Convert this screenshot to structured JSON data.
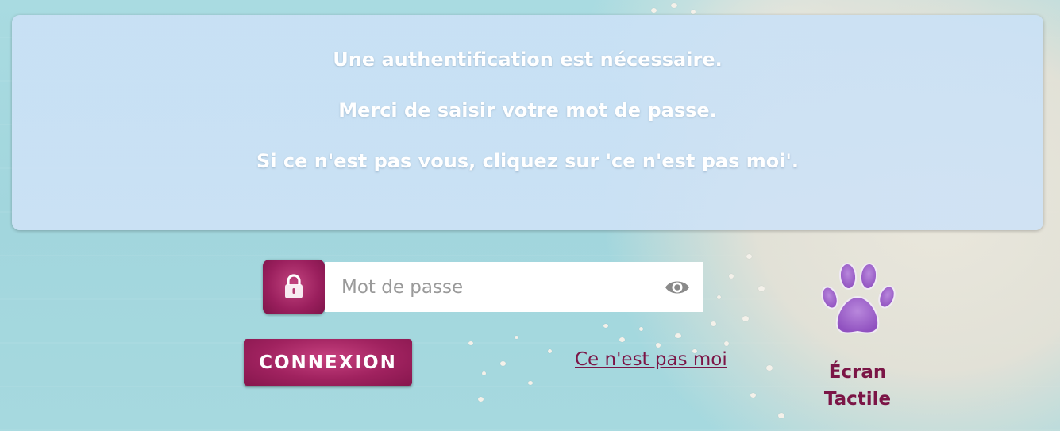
{
  "message": {
    "line1": "Une authentification est nécessaire.",
    "line2": "Merci de saisir votre mot de passe.",
    "line3": "Si ce n'est pas vous, cliquez sur 'ce n'est pas moi'."
  },
  "password": {
    "placeholder": "Mot de passe",
    "value": ""
  },
  "icons": {
    "lock": "lock-icon",
    "eye": "eye-icon",
    "paw": "paw-icon"
  },
  "buttons": {
    "connexion": "CONNEXION"
  },
  "links": {
    "not_me": "Ce n'est pas moi"
  },
  "touch_screen": {
    "line1": "Écran",
    "line2": "Tactile"
  },
  "colors": {
    "accent": "#9a1f5d",
    "link": "#7b1546",
    "paw": "#a062c8",
    "panel": "#cae1f5",
    "background": "#a6d9df"
  }
}
